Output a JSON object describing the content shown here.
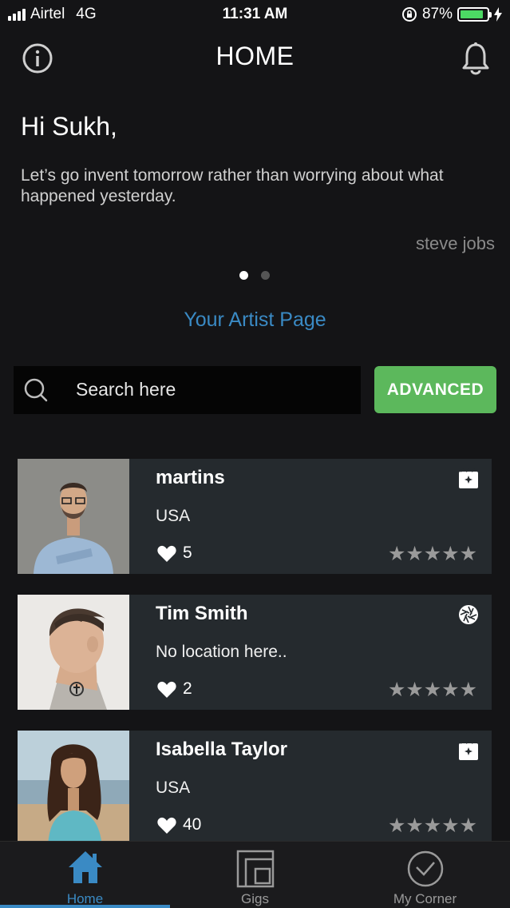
{
  "status_bar": {
    "carrier": "Airtel",
    "network": "4G",
    "time": "11:31 AM",
    "battery": "87%",
    "battery_level": 0.87
  },
  "header": {
    "title": "HOME"
  },
  "hero": {
    "greeting": "Hi Sukh,",
    "quote": "Let’s go invent tomorrow rather than worrying about what happened yesterday.",
    "author": "steve jobs",
    "pages": 2,
    "active_page": 1
  },
  "artist_link": "Your Artist Page",
  "search": {
    "placeholder": "Search here",
    "advanced_label": "ADVANCED"
  },
  "artists": [
    {
      "name": "martins",
      "location": "USA",
      "likes": "5",
      "type_icon": "clapperboard-icon",
      "stars": "★★★★★"
    },
    {
      "name": "Tim Smith",
      "location": "No location here..",
      "likes": "2",
      "type_icon": "camera-aperture-icon",
      "stars": "★★★★★"
    },
    {
      "name": "Isabella Taylor",
      "location": "USA",
      "likes": "40",
      "type_icon": "clapperboard-icon",
      "stars": "★★★★★"
    }
  ],
  "tabs": [
    {
      "label": "Home",
      "icon": "home-icon",
      "active": true
    },
    {
      "label": "Gigs",
      "icon": "gigs-icon",
      "active": false
    },
    {
      "label": "My Corner",
      "icon": "clock-check-icon",
      "active": false
    }
  ],
  "colors": {
    "accent": "#3a8ac4",
    "advanced_button": "#5cb85c",
    "card_bg": "#252a2e",
    "background": "#141416"
  }
}
